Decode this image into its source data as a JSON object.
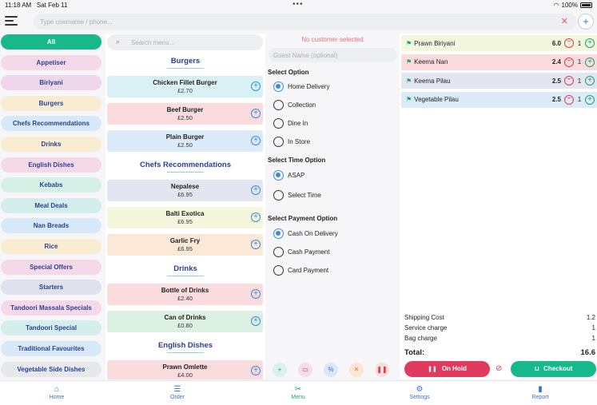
{
  "status": {
    "time": "11:18 AM",
    "date": "Sat Feb 11",
    "battery": "100%"
  },
  "topbar": {
    "search_placeholder": "Type username / phone...",
    "clear_icon": "close-icon",
    "add_icon": "plus-icon"
  },
  "categories": [
    {
      "label": "All",
      "color": "#17b889",
      "active": true
    },
    {
      "label": "Appetiser",
      "color": "#f6d9e8"
    },
    {
      "label": "Biriyani",
      "color": "#eed7ea"
    },
    {
      "label": "Burgers",
      "color": "#f8ecd3"
    },
    {
      "label": "Chefs Recommendations",
      "color": "#d7e9f8"
    },
    {
      "label": "Drinks",
      "color": "#f8ecd3"
    },
    {
      "label": "English Dishes",
      "color": "#f6d9e8"
    },
    {
      "label": "Kebabs",
      "color": "#d5f0e4"
    },
    {
      "label": "Meal Deals",
      "color": "#d3eeec"
    },
    {
      "label": "Nan Breads",
      "color": "#d7e9f8"
    },
    {
      "label": "Rice",
      "color": "#f8ecd3"
    },
    {
      "label": "Special Offers",
      "color": "#f6d9e8"
    },
    {
      "label": "Starters",
      "color": "#dfe2ec"
    },
    {
      "label": "Tandoori Massala Specials",
      "color": "#f6d9e8"
    },
    {
      "label": "Tandoori Special",
      "color": "#d3eeec"
    },
    {
      "label": "Traditional Favourites",
      "color": "#d7e9f8"
    },
    {
      "label": "Vegetable Side Dishes",
      "color": "#e6e8ec"
    }
  ],
  "menu": {
    "search_placeholder": "Search menu...",
    "sections": [
      {
        "title": "Burgers",
        "items": [
          {
            "name": "Chicken Fillet Burger",
            "price": "£2.70",
            "color": "#d8f1f4"
          },
          {
            "name": "Beef Burger",
            "price": "£2.50",
            "color": "#fadcdf"
          },
          {
            "name": "Plain Burger",
            "price": "£2.50",
            "color": "#dcebf9"
          }
        ]
      },
      {
        "title": "Chefs Recommendations",
        "items": [
          {
            "name": "Nepalese",
            "price": "£6.95",
            "color": "#e3e6f1"
          },
          {
            "name": "Balti Exotica",
            "price": "£6.95",
            "color": "#f5f7dc"
          },
          {
            "name": "Garlic Fry",
            "price": "£6.95",
            "color": "#fce8d6"
          }
        ]
      },
      {
        "title": "Drinks",
        "items": [
          {
            "name": "Bottle of Drinks",
            "price": "£2.40",
            "color": "#fadcdf"
          },
          {
            "name": "Can of Drinks",
            "price": "£0.80",
            "color": "#dcf1e3"
          }
        ]
      },
      {
        "title": "English Dishes",
        "items": [
          {
            "name": "Prawn Omlette",
            "price": "£4.00",
            "color": "#fadcdf"
          }
        ]
      }
    ]
  },
  "options": {
    "no_customer": "No customer selected",
    "guest_placeholder": "Guest Name (optional)",
    "order_option_label": "Select Option",
    "order_options": [
      {
        "label": "Home Delivery",
        "selected": true
      },
      {
        "label": "Collection"
      },
      {
        "label": "Dine In"
      },
      {
        "label": "In Store"
      }
    ],
    "time_label": "Select Time Option",
    "time_options": [
      {
        "label": "ASAP",
        "selected": true
      },
      {
        "label": "Select Time"
      }
    ],
    "payment_label": "Select Payment Option",
    "payment_options": [
      {
        "label": "Cash On Delivery",
        "selected": true
      },
      {
        "label": "Cash Payment"
      },
      {
        "label": "Card Payment"
      }
    ],
    "tools": [
      {
        "icon": "plus-icon",
        "glyph": "+",
        "bg": "#dcf1ea",
        "fg": "#1aa36a"
      },
      {
        "icon": "comment-icon",
        "glyph": "▭",
        "bg": "#f6dceb",
        "fg": "#c0307a"
      },
      {
        "icon": "percent-icon",
        "glyph": "%",
        "bg": "#dce6f6",
        "fg": "#3b6fd3"
      },
      {
        "icon": "close-icon",
        "glyph": "✕",
        "bg": "#fbe5d6",
        "fg": "#e07a2e"
      },
      {
        "icon": "pause-icon",
        "glyph": "❚❚",
        "bg": "#fadcdf",
        "fg": "#e03a4e"
      }
    ]
  },
  "order": {
    "lines": [
      {
        "name": "Prawn Biriyani",
        "qty": "6.0",
        "count": "1",
        "color": "#f3f7de"
      },
      {
        "name": "Keema Nan",
        "qty": "2.4",
        "count": "1",
        "color": "#fadcdf"
      },
      {
        "name": "Keema Pilau",
        "qty": "2.5",
        "count": "1",
        "color": "#e3e6f1"
      },
      {
        "name": "Vegetable Pilau",
        "qty": "2.5",
        "count": "1",
        "color": "#dcebf9"
      }
    ],
    "charges": [
      {
        "label": "Shipping Cost",
        "value": "1.2"
      },
      {
        "label": "Service charge",
        "value": "1"
      },
      {
        "label": "Bag charge",
        "value": "1"
      }
    ],
    "total_label": "Total:",
    "total_value": "16.6",
    "on_hold_label": "On Hold",
    "checkout_label": "Checkout"
  },
  "nav": [
    {
      "label": "Home",
      "icon": "home-icon",
      "glyph": "⌂"
    },
    {
      "label": "Order",
      "icon": "list-icon",
      "glyph": "☰"
    },
    {
      "label": "Menu",
      "icon": "utensils-icon",
      "glyph": "✂",
      "active": true
    },
    {
      "label": "Settings",
      "icon": "gear-icon",
      "glyph": "⚙"
    },
    {
      "label": "Report",
      "icon": "chart-icon",
      "glyph": "▮"
    }
  ]
}
